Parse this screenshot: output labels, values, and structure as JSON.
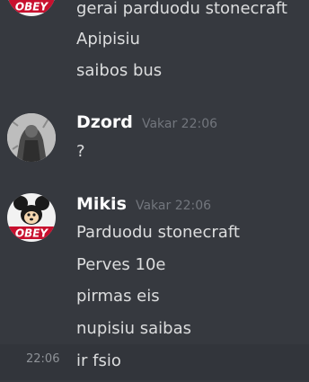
{
  "continued_messages": [
    "gerai parduodu stonecraft",
    "Apipisiu",
    "saibos bus"
  ],
  "groups": [
    {
      "username": "Dzord",
      "timestamp": "Vakar 22:06",
      "messages": [
        "?"
      ]
    },
    {
      "username": "Mikis",
      "timestamp": "Vakar 22:06",
      "messages": [
        "Parduodu stonecraft",
        "Perves 10e",
        "pirmas eis",
        "nupisiu saibas",
        "ir fsio"
      ]
    }
  ],
  "hovered_message_time": "22:06",
  "colors": {
    "background": "#36393f",
    "hover_background": "#32353b",
    "username": "#ffffff",
    "text": "#dcddde",
    "timestamp": "#72767d"
  }
}
